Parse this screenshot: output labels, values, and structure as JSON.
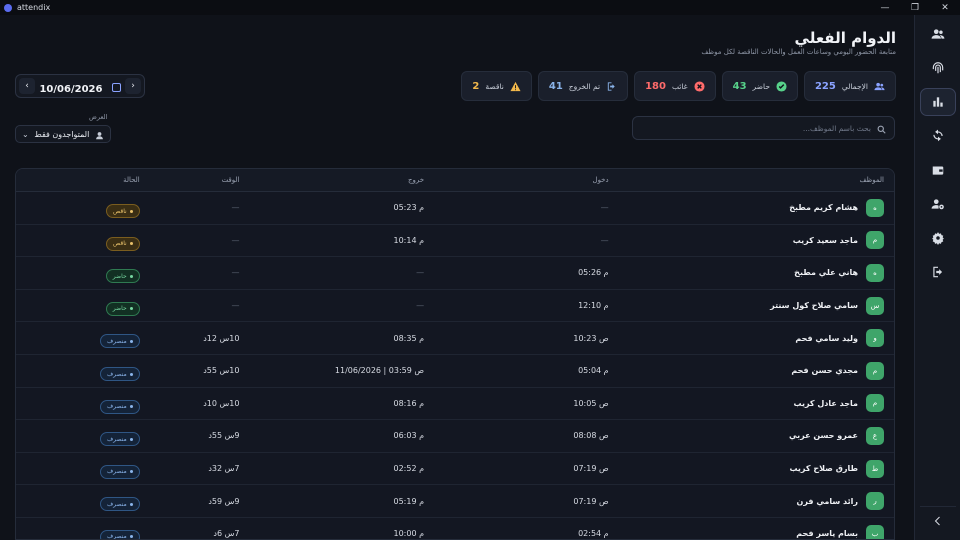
{
  "app": {
    "title": "attendix"
  },
  "window": {
    "minimize": "—",
    "maximize": "❐",
    "close": "✕"
  },
  "header": {
    "title": "الدوام الفعلي",
    "subtitle": "متابعة الحضور اليومي وساعات العمل والحالات الناقصة لكل موظف"
  },
  "stats": [
    {
      "key": "total",
      "label": "الإجمالي",
      "value": "225",
      "color": "#8aa2ff",
      "icon": "users-icon"
    },
    {
      "key": "present",
      "label": "حاضر",
      "value": "43",
      "color": "#57d18a",
      "icon": "check-circle-icon"
    },
    {
      "key": "absent",
      "label": "غائب",
      "value": "180",
      "color": "#ff6b6b",
      "icon": "x-circle-icon"
    },
    {
      "key": "left",
      "label": "تم الخروج",
      "value": "41",
      "color": "#8ab4ea",
      "icon": "logout-icon"
    },
    {
      "key": "partial",
      "label": "ناقصة",
      "value": "2",
      "color": "#f2b84b",
      "icon": "warning-icon"
    }
  ],
  "date": {
    "value": "10/06/2026",
    "prev": "‹",
    "next": "›"
  },
  "view": {
    "label": "العرض",
    "selected": "المتواجدون فقط"
  },
  "search": {
    "placeholder": "بحث باسم الموظف..."
  },
  "table": {
    "headers": {
      "employee": "الموظف",
      "check_in": "دخول",
      "check_out": "خروج",
      "time": "الوقت",
      "status": "الحالة"
    },
    "rows": [
      {
        "initial": "ه",
        "name": "هشام كريم مطبخ",
        "in": "—",
        "out": "م 05:23",
        "time": "—",
        "status": "ناقص",
        "status_type": "partial"
      },
      {
        "initial": "م",
        "name": "ماجد سعيد كريب",
        "in": "—",
        "out": "م 10:14",
        "time": "—",
        "status": "ناقص",
        "status_type": "partial"
      },
      {
        "initial": "ه",
        "name": "هاني علي مطبخ",
        "in": "م 05:26",
        "out": "—",
        "time": "—",
        "status": "حاضر",
        "status_type": "present"
      },
      {
        "initial": "س",
        "name": "سامي صلاح كول سنتر",
        "in": "م 12:10",
        "out": "—",
        "time": "—",
        "status": "حاضر",
        "status_type": "present"
      },
      {
        "initial": "و",
        "name": "وليد سامي فحم",
        "in": "ص 10:23",
        "out": "م 08:35",
        "time": "10س 12د",
        "status": "منصرف",
        "status_type": "left"
      },
      {
        "initial": "م",
        "name": "مجدي حسن فحم",
        "in": "م 05:04",
        "out": "ص 03:59 | 11/06/2026",
        "time": "10س 55د",
        "status": "منصرف",
        "status_type": "left"
      },
      {
        "initial": "م",
        "name": "ماجد عادل كريب",
        "in": "ص 10:05",
        "out": "م 08:16",
        "time": "10س 10د",
        "status": "منصرف",
        "status_type": "left"
      },
      {
        "initial": "ع",
        "name": "عمرو حسن عربي",
        "in": "ص 08:08",
        "out": "م 06:03",
        "time": "9س 55د",
        "status": "منصرف",
        "status_type": "left"
      },
      {
        "initial": "ط",
        "name": "طارق صلاح كريب",
        "in": "ص 07:19",
        "out": "م 02:52",
        "time": "7س 32د",
        "status": "منصرف",
        "status_type": "left"
      },
      {
        "initial": "ر",
        "name": "رائد سامي فرن",
        "in": "ص 07:19",
        "out": "م 05:19",
        "time": "9س 59د",
        "status": "منصرف",
        "status_type": "left"
      },
      {
        "initial": "ب",
        "name": "بسام ياسر فحم",
        "in": "م 02:54",
        "out": "م 10:00",
        "time": "7س 6د",
        "status": "منصرف",
        "status_type": "left"
      }
    ]
  },
  "sidebar": {
    "items": [
      {
        "name": "users",
        "icon": "users-icon"
      },
      {
        "name": "fingerprint",
        "icon": "fingerprint-icon"
      },
      {
        "name": "reports",
        "icon": "bar-chart-icon",
        "active": true
      },
      {
        "name": "sync",
        "icon": "sync-icon"
      },
      {
        "name": "wallet",
        "icon": "wallet-icon"
      },
      {
        "name": "user-settings",
        "icon": "user-gear-icon"
      },
      {
        "name": "settings",
        "icon": "gear-icon"
      },
      {
        "name": "logout",
        "icon": "logout-icon"
      }
    ],
    "collapse": "chevron-left-icon"
  }
}
